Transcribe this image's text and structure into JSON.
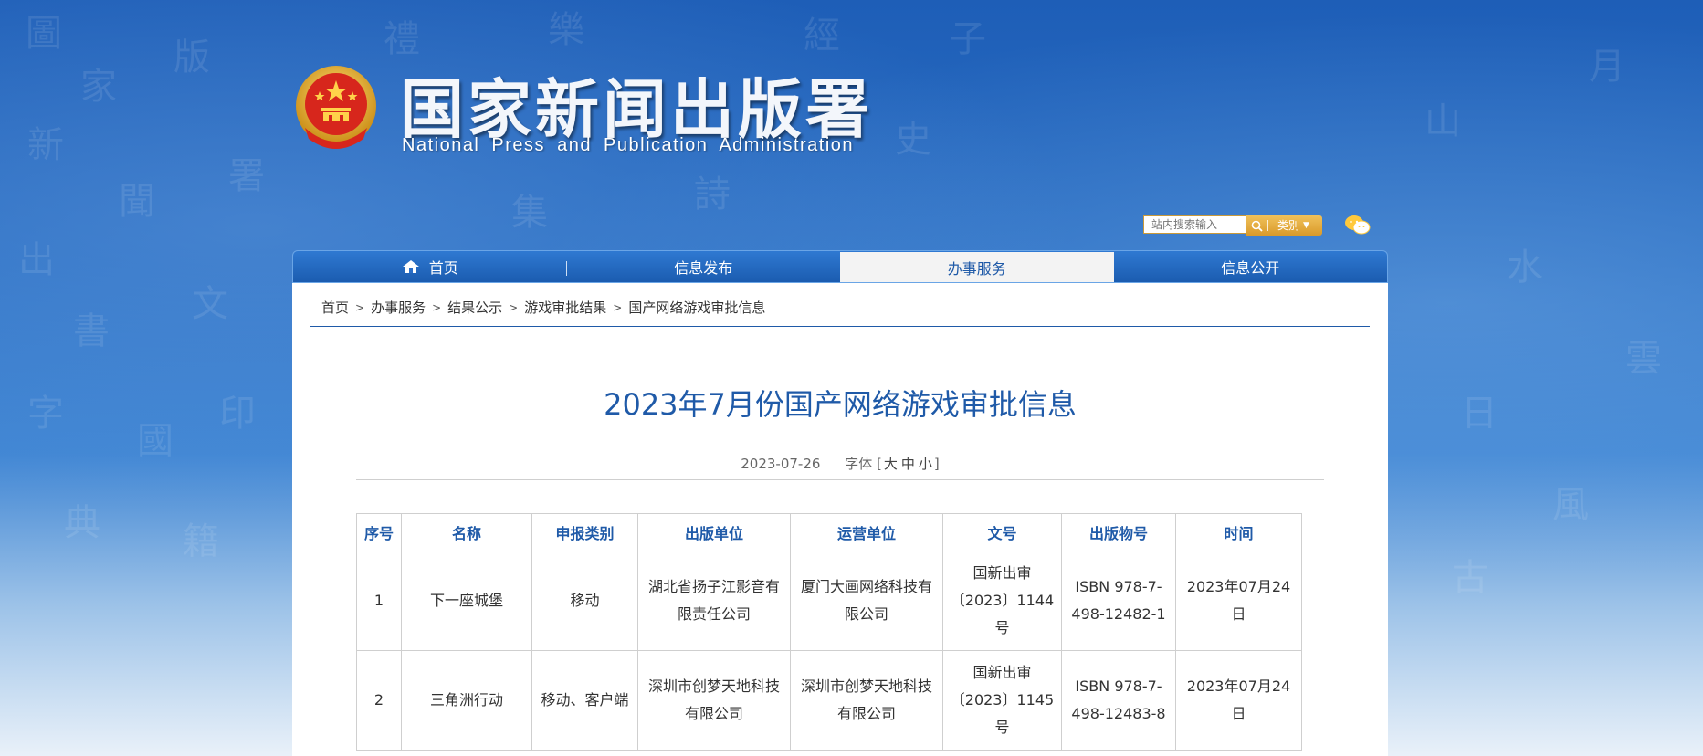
{
  "site": {
    "title_cn": "国家新闻出版署",
    "title_en": "National  Press and Publication Administration",
    "background_glyphs": [
      "圖",
      "家",
      "新",
      "聞",
      "出",
      "版",
      "署",
      "書",
      "文",
      "字",
      "國",
      "印",
      "典",
      "籍",
      "禮",
      "樂",
      "詩",
      "經",
      "史",
      "子",
      "集",
      "山",
      "水",
      "月",
      "日",
      "雲",
      "風",
      "古"
    ]
  },
  "search": {
    "placeholder": "站内搜索输入",
    "category_label": "类别",
    "search_icon": "search-icon",
    "wechat_icon": "wechat-icon"
  },
  "nav": {
    "items": [
      {
        "label": "首页",
        "icon": "home-icon"
      },
      {
        "label": "信息发布"
      },
      {
        "label": "办事服务",
        "active": true
      },
      {
        "label": "信息公开"
      }
    ]
  },
  "breadcrumb": [
    "首页",
    "办事服务",
    "结果公示",
    "游戏审批结果",
    "国产网络游戏审批信息"
  ],
  "article": {
    "title": "2023年7月份国产网络游戏审批信息",
    "date": "2023-07-26",
    "font_label": "字体",
    "font_sizes": [
      "大",
      "中",
      "小"
    ]
  },
  "table": {
    "headers": [
      "序号",
      "名称",
      "申报类别",
      "出版单位",
      "运营单位",
      "文号",
      "出版物号",
      "时间"
    ],
    "rows": [
      {
        "no": "1",
        "name": "下一座城堡",
        "category": "移动",
        "publisher": "湖北省扬子江影音有限责任公司",
        "operator": "厦门大画网络科技有限公司",
        "approval": "国新出审〔2023〕1144号",
        "isbn": "ISBN 978-7-498-12482-1",
        "date": "2023年07月24日"
      },
      {
        "no": "2",
        "name": "三角洲行动",
        "category": "移动、客户端",
        "publisher": "深圳市创梦天地科技有限公司",
        "operator": "深圳市创梦天地科技有限公司",
        "approval": "国新出审〔2023〕1145号",
        "isbn": "ISBN 978-7-498-12483-8",
        "date": "2023年07月24日"
      }
    ]
  },
  "colors": {
    "brand_blue": "#1f5aa8",
    "nav_blue": "#1b5cb0",
    "search_gold": "#e0a535"
  }
}
